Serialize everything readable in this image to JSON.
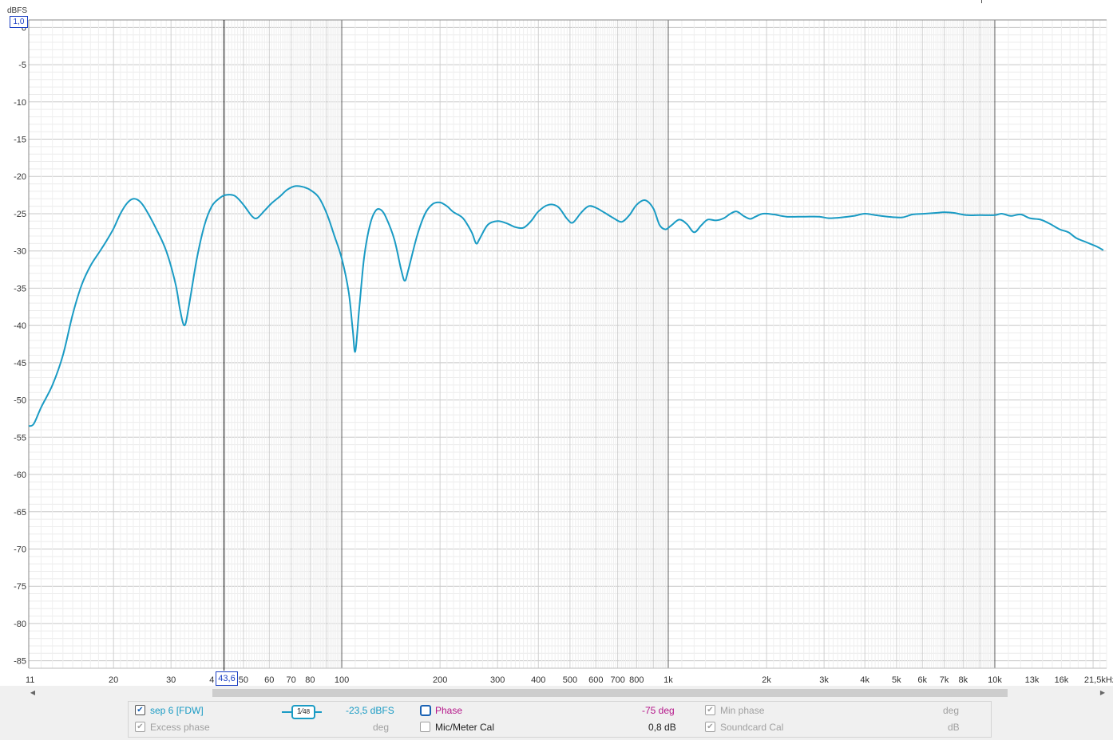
{
  "axis": {
    "y_unit": "dBFS",
    "top_value": "1,0",
    "cursor_value": "43,6"
  },
  "chart_data": {
    "type": "line",
    "title": "",
    "xlabel": "",
    "ylabel": "dBFS",
    "x_scale": "log",
    "xlim": [
      11,
      22000
    ],
    "ylim": [
      -86,
      1
    ],
    "grid": true,
    "x_tick_values": [
      11,
      20,
      30,
      40,
      50,
      60,
      70,
      80,
      100,
      200,
      300,
      400,
      500,
      600,
      700,
      800,
      1000,
      2000,
      3000,
      4000,
      5000,
      6000,
      7000,
      8000,
      10000,
      13000,
      16000,
      21500
    ],
    "x_tick_labels": [
      "11",
      "20",
      "30",
      "4",
      "50",
      "60",
      "70",
      "80",
      "100",
      "200",
      "300",
      "400",
      "500",
      "600",
      "700",
      "800",
      "1k",
      "2k",
      "3k",
      "4k",
      "5k",
      "6k",
      "7k",
      "8k",
      "10k",
      "13k",
      "16k",
      "21,5kHz"
    ],
    "y_tick_values": [
      0,
      -5,
      -10,
      -15,
      -20,
      -25,
      -30,
      -35,
      -40,
      -45,
      -50,
      -55,
      -60,
      -65,
      -70,
      -75,
      -80,
      -85
    ],
    "y_tick_labels": [
      "0",
      "-5",
      "-10",
      "-15",
      "-20",
      "-25",
      "-30",
      "-35",
      "-40",
      "-45",
      "-50",
      "-55",
      "-60",
      "-65",
      "-70",
      "-75",
      "-80",
      "-85"
    ],
    "cursor_x": 43.6,
    "series": [
      {
        "name": "sep 6 [FDW]",
        "color": "#1a9bc4",
        "points": [
          [
            11,
            -53.5
          ],
          [
            11.4,
            -53.2
          ],
          [
            12,
            -51
          ],
          [
            13,
            -48
          ],
          [
            14,
            -44
          ],
          [
            15,
            -38.5
          ],
          [
            16,
            -34.5
          ],
          [
            17,
            -32
          ],
          [
            18,
            -30.3
          ],
          [
            19,
            -28.7
          ],
          [
            20,
            -27
          ],
          [
            21,
            -25
          ],
          [
            22,
            -23.6
          ],
          [
            23,
            -23
          ],
          [
            24,
            -23.3
          ],
          [
            25,
            -24.3
          ],
          [
            27,
            -27
          ],
          [
            29,
            -30
          ],
          [
            31,
            -34.5
          ],
          [
            32,
            -38
          ],
          [
            33,
            -40
          ],
          [
            34,
            -37.5
          ],
          [
            36,
            -31
          ],
          [
            38,
            -26.5
          ],
          [
            40,
            -24
          ],
          [
            42,
            -23
          ],
          [
            44,
            -22.5
          ],
          [
            47,
            -22.6
          ],
          [
            50,
            -23.8
          ],
          [
            53,
            -25.3
          ],
          [
            55,
            -25.6
          ],
          [
            58,
            -24.6
          ],
          [
            61,
            -23.6
          ],
          [
            65,
            -22.6
          ],
          [
            68,
            -21.8
          ],
          [
            72,
            -21.3
          ],
          [
            76,
            -21.4
          ],
          [
            80,
            -21.8
          ],
          [
            85,
            -22.8
          ],
          [
            90,
            -25
          ],
          [
            95,
            -28
          ],
          [
            100,
            -31
          ],
          [
            105,
            -35.5
          ],
          [
            108,
            -40.5
          ],
          [
            110,
            -43.5
          ],
          [
            113,
            -38
          ],
          [
            117,
            -31
          ],
          [
            122,
            -26.5
          ],
          [
            127,
            -24.6
          ],
          [
            132,
            -24.5
          ],
          [
            137,
            -25.6
          ],
          [
            145,
            -28.5
          ],
          [
            152,
            -32.5
          ],
          [
            156,
            -34
          ],
          [
            160,
            -32.5
          ],
          [
            170,
            -28
          ],
          [
            180,
            -25
          ],
          [
            190,
            -23.7
          ],
          [
            200,
            -23.5
          ],
          [
            210,
            -24
          ],
          [
            220,
            -24.8
          ],
          [
            235,
            -25.6
          ],
          [
            250,
            -27.5
          ],
          [
            258,
            -29
          ],
          [
            265,
            -28.3
          ],
          [
            280,
            -26.5
          ],
          [
            300,
            -26
          ],
          [
            320,
            -26.3
          ],
          [
            340,
            -26.8
          ],
          [
            360,
            -26.9
          ],
          [
            380,
            -26
          ],
          [
            400,
            -24.7
          ],
          [
            430,
            -23.8
          ],
          [
            460,
            -24.1
          ],
          [
            490,
            -25.7
          ],
          [
            510,
            -26.2
          ],
          [
            540,
            -24.9
          ],
          [
            570,
            -24
          ],
          [
            600,
            -24.2
          ],
          [
            640,
            -24.9
          ],
          [
            680,
            -25.6
          ],
          [
            720,
            -26.1
          ],
          [
            760,
            -25.2
          ],
          [
            800,
            -23.8
          ],
          [
            850,
            -23.2
          ],
          [
            900,
            -24.3
          ],
          [
            940,
            -26.5
          ],
          [
            980,
            -27.1
          ],
          [
            1020,
            -26.6
          ],
          [
            1080,
            -25.8
          ],
          [
            1140,
            -26.4
          ],
          [
            1200,
            -27.5
          ],
          [
            1260,
            -26.6
          ],
          [
            1320,
            -25.8
          ],
          [
            1400,
            -25.9
          ],
          [
            1480,
            -25.6
          ],
          [
            1550,
            -25
          ],
          [
            1620,
            -24.7
          ],
          [
            1700,
            -25.3
          ],
          [
            1780,
            -25.7
          ],
          [
            1850,
            -25.4
          ],
          [
            1950,
            -25
          ],
          [
            2100,
            -25.1
          ],
          [
            2300,
            -25.4
          ],
          [
            2600,
            -25.4
          ],
          [
            2900,
            -25.4
          ],
          [
            3100,
            -25.6
          ],
          [
            3400,
            -25.5
          ],
          [
            3700,
            -25.3
          ],
          [
            4000,
            -25
          ],
          [
            4300,
            -25.2
          ],
          [
            4700,
            -25.4
          ],
          [
            5200,
            -25.5
          ],
          [
            5600,
            -25.1
          ],
          [
            6100,
            -25
          ],
          [
            6600,
            -24.9
          ],
          [
            7000,
            -24.8
          ],
          [
            7500,
            -24.9
          ],
          [
            8200,
            -25.2
          ],
          [
            9000,
            -25.2
          ],
          [
            10000,
            -25.2
          ],
          [
            10500,
            -25
          ],
          [
            11200,
            -25.3
          ],
          [
            12000,
            -25.1
          ],
          [
            12800,
            -25.6
          ],
          [
            13800,
            -25.8
          ],
          [
            14800,
            -26.4
          ],
          [
            15800,
            -27.1
          ],
          [
            16800,
            -27.5
          ],
          [
            17800,
            -28.3
          ],
          [
            19000,
            -28.8
          ],
          [
            20500,
            -29.4
          ],
          [
            21500,
            -29.9
          ]
        ]
      }
    ]
  },
  "legend": {
    "row1": {
      "measurement": "sep 6 [FDW]",
      "smoothing_num": "1",
      "smoothing_den": "48",
      "value": "-23,5 dBFS",
      "phase_label": "Phase",
      "phase_value": "-75 deg",
      "min_phase_label": "Min phase",
      "min_phase_unit": "deg"
    },
    "row2": {
      "excess_phase_label": "Excess phase",
      "excess_phase_unit": "deg",
      "mic_cal_label": "Mic/Meter Cal",
      "mic_cal_value": "0,8 dB",
      "soundcard_cal_label": "Soundcard Cal",
      "soundcard_cal_unit": "dB"
    }
  }
}
